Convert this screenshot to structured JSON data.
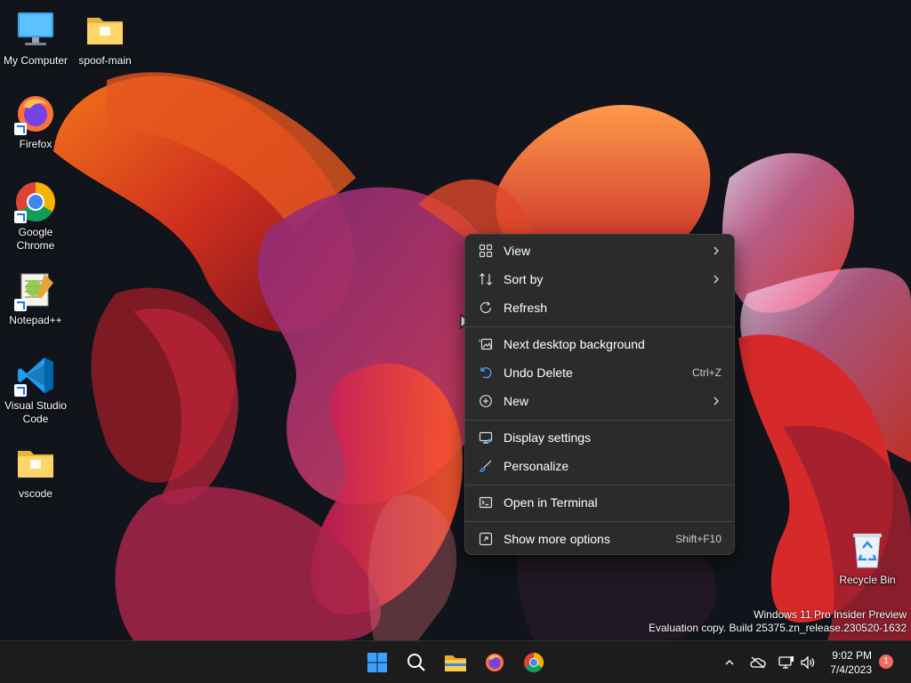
{
  "desktop": {
    "icons": [
      {
        "label": "My Computer"
      },
      {
        "label": "spoof-main"
      },
      {
        "label": "Firefox"
      },
      {
        "label": "Google Chrome"
      },
      {
        "label": "Notepad++"
      },
      {
        "label": "Visual Studio Code"
      },
      {
        "label": "vscode"
      },
      {
        "label": "Recycle Bin"
      }
    ]
  },
  "context_menu": {
    "items": [
      {
        "label": "View",
        "icon": "grid-view-icon",
        "submenu": true
      },
      {
        "label": "Sort by",
        "icon": "sort-arrows-icon",
        "submenu": true
      },
      {
        "label": "Refresh",
        "icon": "refresh-icon"
      },
      {
        "label": "Next desktop background",
        "icon": "next-background-icon"
      },
      {
        "label": "Undo Delete",
        "icon": "undo-icon",
        "shortcut": "Ctrl+Z"
      },
      {
        "label": "New",
        "icon": "plus-circle-icon",
        "submenu": true
      },
      {
        "label": "Display settings",
        "icon": "display-icon"
      },
      {
        "label": "Personalize",
        "icon": "brush-icon"
      },
      {
        "label": "Open in Terminal",
        "icon": "terminal-icon"
      },
      {
        "label": "Show more options",
        "icon": "more-options-icon",
        "shortcut": "Shift+F10"
      }
    ]
  },
  "watermark": {
    "line1": "Windows 11 Pro Insider Preview",
    "line2": "Evaluation copy. Build 25375.zn_release.230520-1632"
  },
  "taskbar": {
    "pinned": [
      "start-icon",
      "search-icon",
      "file-explorer-icon",
      "firefox-icon",
      "chrome-icon"
    ],
    "clock": {
      "time": "9:02 PM",
      "date": "7/4/2023"
    },
    "notification_count": "1"
  },
  "colors": {
    "menu_bg": "#2b2b2b",
    "taskbar_bg": "#1c1c1c",
    "accent": "#0078d4",
    "badge": "#f26b5b"
  }
}
